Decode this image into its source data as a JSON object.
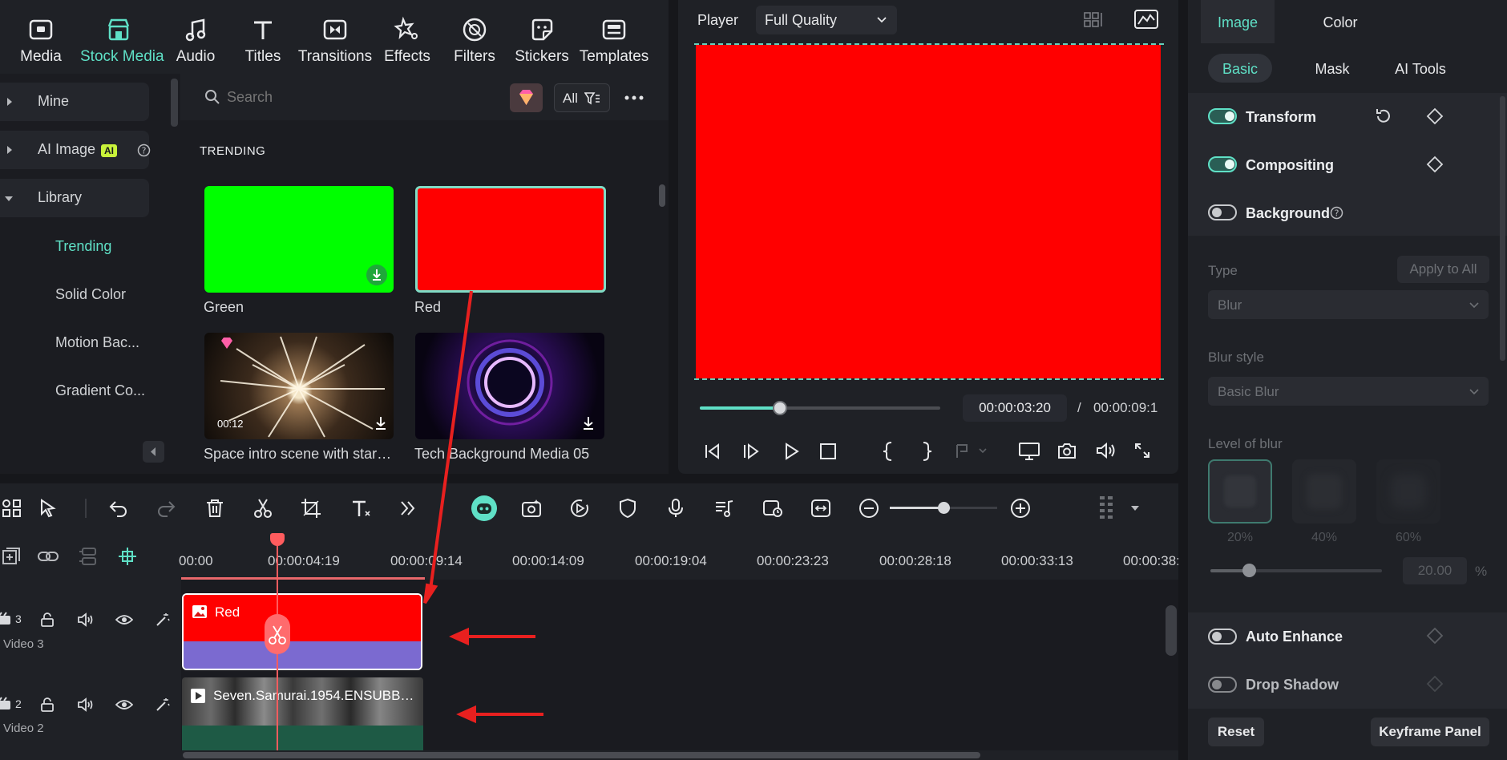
{
  "top_tabs": [
    {
      "label": "Media",
      "icon": "media-icon"
    },
    {
      "label": "Stock Media",
      "icon": "stock-media-icon",
      "active": true
    },
    {
      "label": "Audio",
      "icon": "music-note-icon"
    },
    {
      "label": "Titles",
      "icon": "text-t-icon"
    },
    {
      "label": "Transitions",
      "icon": "transitions-icon"
    },
    {
      "label": "Effects",
      "icon": "effects-icon"
    },
    {
      "label": "Filters",
      "icon": "filters-icon"
    },
    {
      "label": "Stickers",
      "icon": "stickers-icon"
    },
    {
      "label": "Templates",
      "icon": "templates-icon"
    }
  ],
  "left_nav": {
    "mine": "Mine",
    "ai_image": "AI Image",
    "ai_badge": "AI",
    "library": "Library",
    "sub_items": [
      "Trending",
      "Solid Color",
      "Motion Bac...",
      "Gradient Co..."
    ]
  },
  "media": {
    "search_placeholder": "Search",
    "filter_label": "All",
    "section_title": "TRENDING",
    "items": [
      {
        "caption": "Green",
        "color": "#00ff00"
      },
      {
        "caption": "Red",
        "color": "#ff0000"
      },
      {
        "caption": "Space intro scene with stars ...",
        "duration": "00:12"
      },
      {
        "caption": "Tech Background Media 05"
      }
    ]
  },
  "player": {
    "label": "Player",
    "quality": "Full Quality",
    "current_time": "00:00:03:20",
    "separator": "/",
    "total_time": "00:00:09:1",
    "progress": 0.2,
    "frame_color": "#ff0000"
  },
  "inspector": {
    "tabs": [
      "Image",
      "Color"
    ],
    "subtabs": [
      "Basic",
      "Mask",
      "AI Tools"
    ],
    "transform": "Transform",
    "compositing": "Compositing",
    "background": "Background",
    "type_label": "Type",
    "apply_all": "Apply to All",
    "type_value": "Blur",
    "blur_style_label": "Blur style",
    "blur_style_value": "Basic Blur",
    "level_label": "Level of blur",
    "levels": [
      "20%",
      "40%",
      "60%"
    ],
    "level_value": "20.00",
    "level_unit": "%",
    "auto_enhance": "Auto Enhance",
    "drop_shadow": "Drop Shadow",
    "reset": "Reset",
    "keyframe": "Keyframe Panel"
  },
  "timeline": {
    "ruler": [
      "00:00",
      "00:00:04:19",
      "00:00:09:14",
      "00:00:14:09",
      "00:00:19:04",
      "00:00:23:23",
      "00:00:28:18",
      "00:00:33:13",
      "00:00:38:"
    ],
    "tracks": [
      {
        "label": "Video 3",
        "number": "3",
        "clip": "Red"
      },
      {
        "label": "Video 2",
        "number": "2",
        "clip": "Seven.Samurai.1954.ENSUBBE..."
      }
    ]
  },
  "colors": {
    "accent": "#5fe0c6",
    "clip_red": "#ff0000",
    "clip_purple": "#7b6ad0",
    "annotation": "#e8201f"
  }
}
